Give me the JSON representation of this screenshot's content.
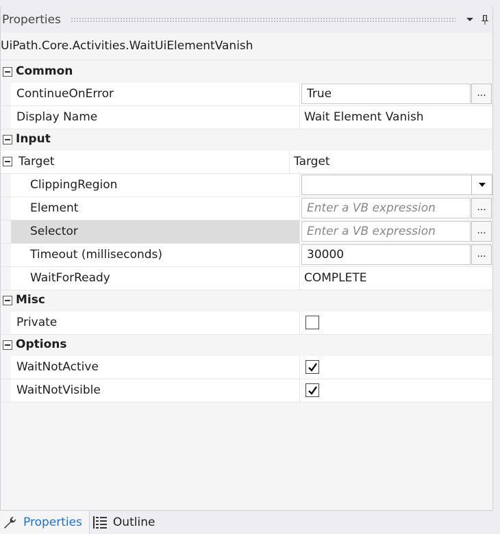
{
  "panel": {
    "title": "Properties",
    "dropdown_icon": "chevron-down-icon",
    "pin_icon": "pin-icon",
    "type_name": "UiPath.Core.Activities.WaitUiElementVanish"
  },
  "categories": {
    "common": "Common",
    "input": "Input",
    "misc": "Misc",
    "options": "Options"
  },
  "properties": {
    "continue_on_error": {
      "label": "ContinueOnError",
      "value": "True"
    },
    "display_name": {
      "label": "Display Name",
      "value": "Wait Element Vanish"
    },
    "target": {
      "label": "Target",
      "value": "Target"
    },
    "clipping_region": {
      "label": "ClippingRegion",
      "value": ""
    },
    "element": {
      "label": "Element",
      "placeholder": "Enter a VB expression"
    },
    "selector": {
      "label": "Selector",
      "placeholder": "Enter a VB expression"
    },
    "timeout": {
      "label": "Timeout (milliseconds)",
      "value": "30000"
    },
    "wait_for_ready": {
      "label": "WaitForReady",
      "value": "COMPLETE"
    },
    "private": {
      "label": "Private",
      "checked": false
    },
    "wait_not_active": {
      "label": "WaitNotActive",
      "checked": true
    },
    "wait_not_visible": {
      "label": "WaitNotVisible",
      "checked": true
    }
  },
  "ellipsis_label": "...",
  "tabs": [
    {
      "label": "Properties",
      "icon": "wrench-icon",
      "active": true
    },
    {
      "label": "Outline",
      "icon": "outline-list-icon",
      "active": false
    }
  ],
  "colors": {
    "accent": "#1e6fd0",
    "selected_row": "#dcdcdc"
  }
}
